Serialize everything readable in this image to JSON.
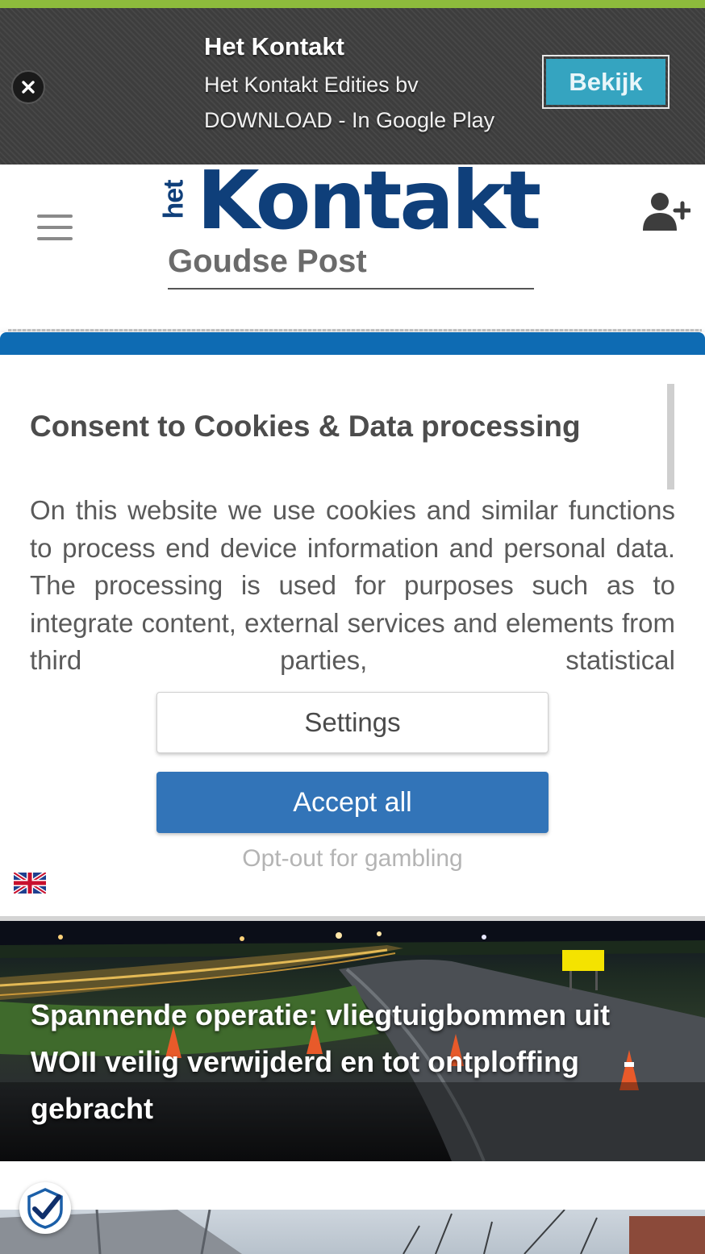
{
  "app_banner": {
    "title": "Het Kontakt",
    "publisher": "Het Kontakt Edities bv",
    "download_text": "DOWNLOAD - In Google Play",
    "cta_label": "Bekijk",
    "close_icon": "close-icon"
  },
  "header": {
    "logo_prefix": "het",
    "logo_name": "Kontakt",
    "logo_subtitle": "Goudse Post",
    "menu_icon": "hamburger-icon",
    "account_icon": "user-plus-icon"
  },
  "cookie_dialog": {
    "title": "Consent to Cookies & Data processing",
    "body": "On this website we use cookies and similar functions to process end device information and personal data. The processing is used for purposes such as to integrate content, external services and elements from third parties, statistical",
    "settings_label": "Settings",
    "accept_label": "Accept all",
    "optout_label": "Opt-out for gambling",
    "language_icon": "uk-flag-icon"
  },
  "hero_article": {
    "title": "Spannende operatie: vliegtuigbommen uit WOII veilig verwijderd en tot ontploffing gebracht"
  },
  "consent_fab": {
    "icon": "consent-check-icon"
  },
  "colors": {
    "accent_green": "#8dbb3c",
    "brand_blue": "#0f3f7a",
    "dialog_bar": "#0e6bb3",
    "accept_button": "#3274b8",
    "banner_button": "#35a4c0"
  }
}
